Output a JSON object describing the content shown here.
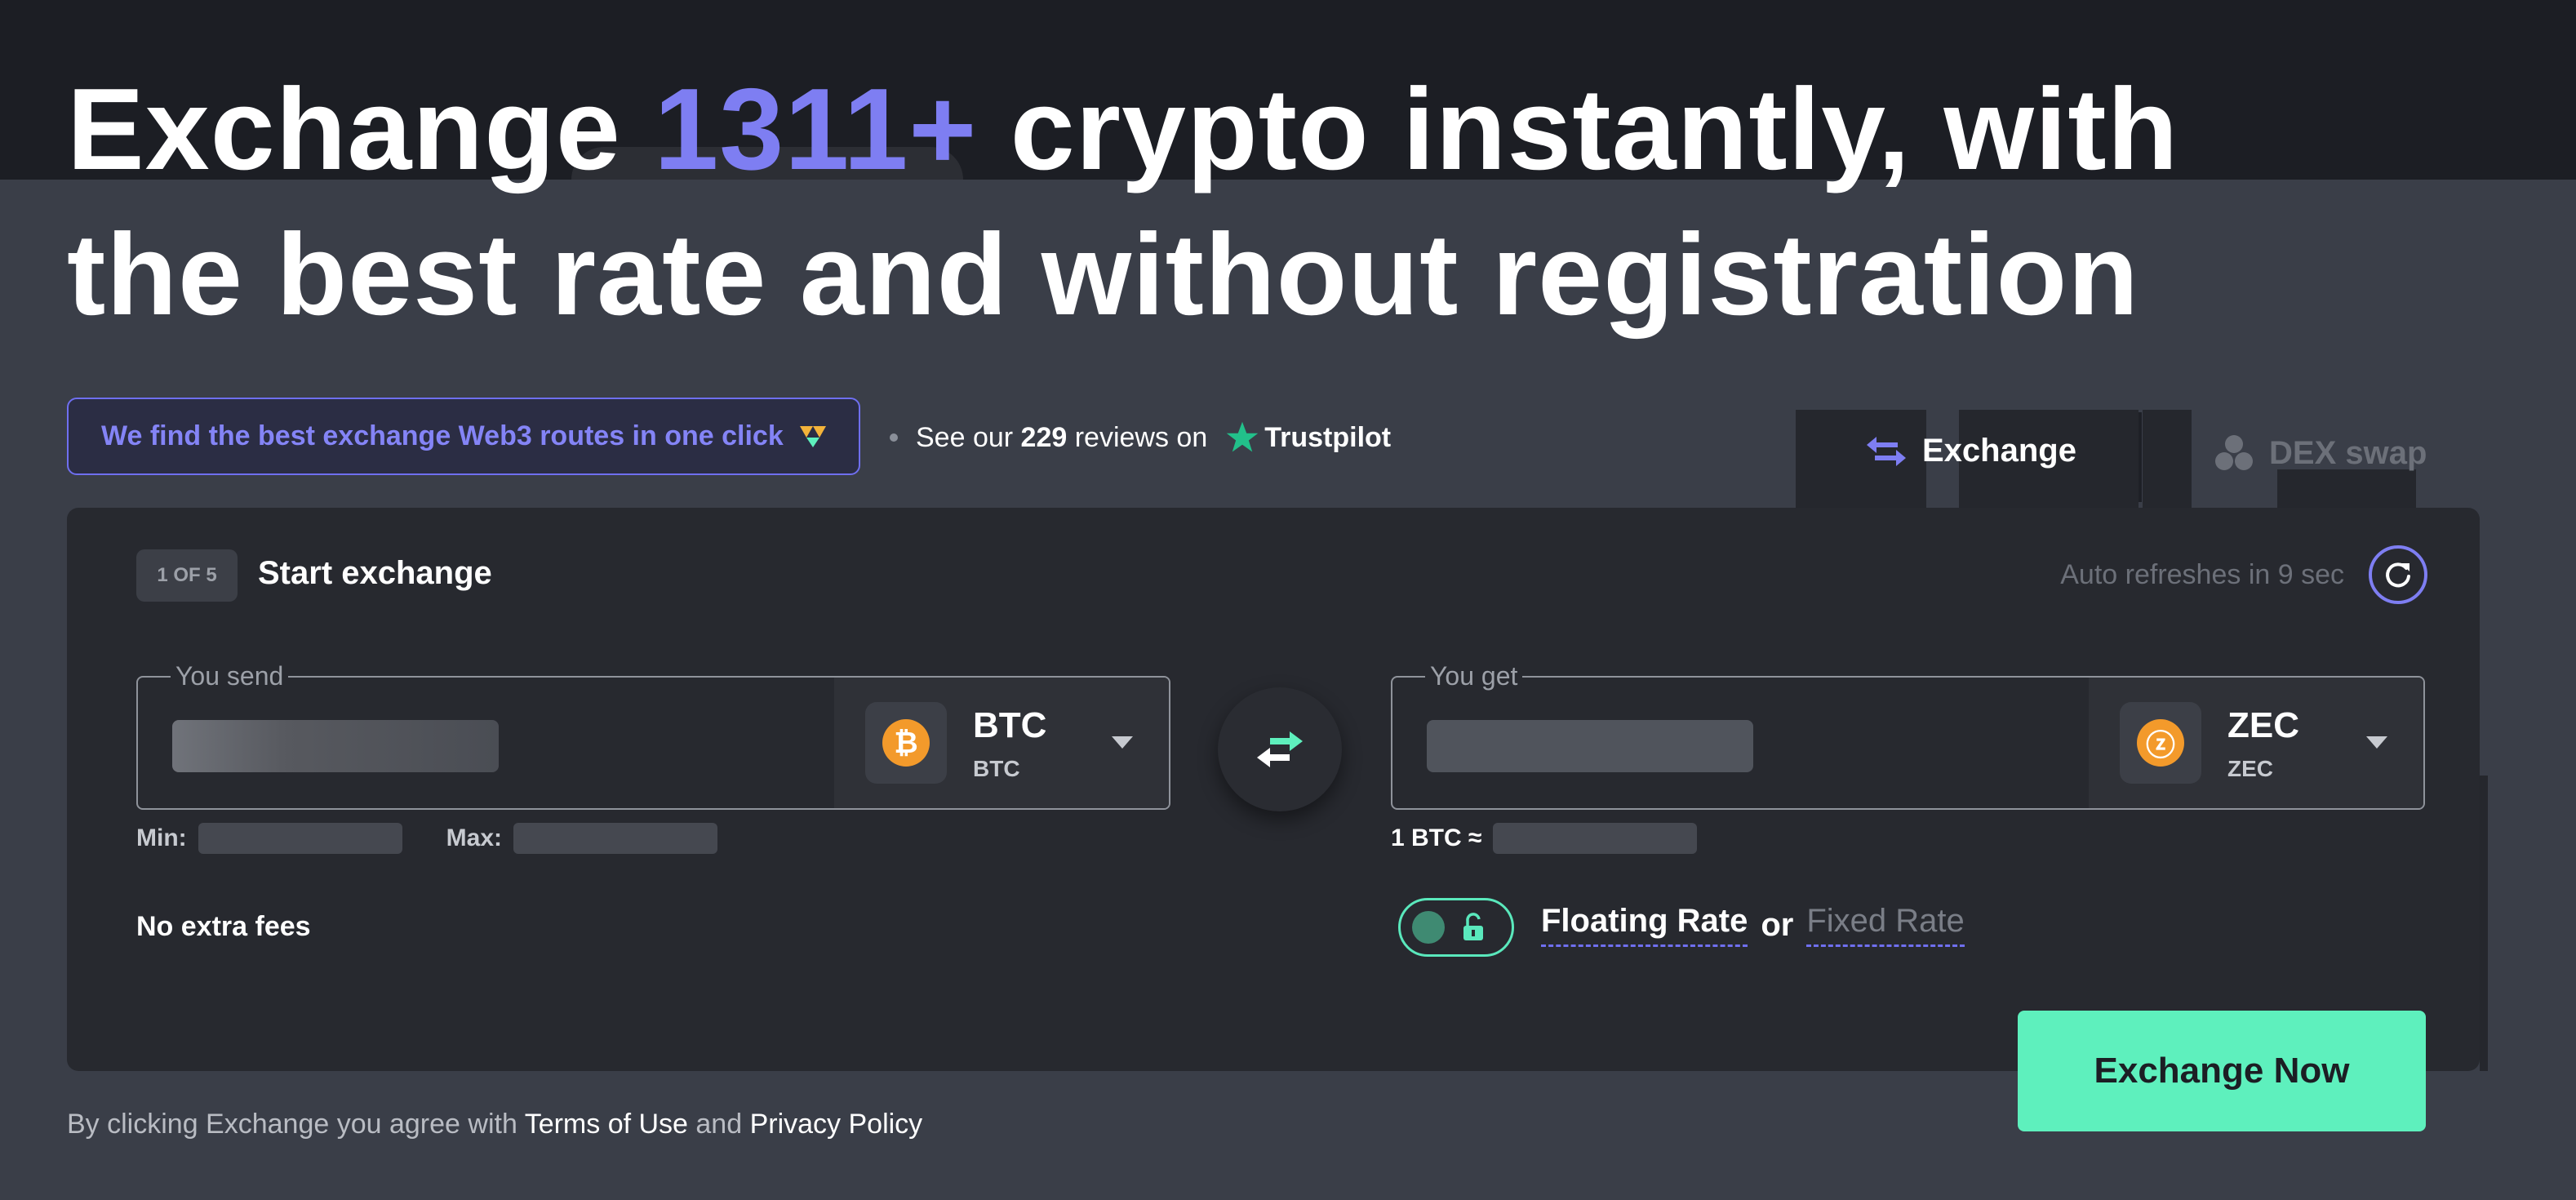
{
  "headline": {
    "pre": "Exchange ",
    "count": "1311+",
    "post": " crypto instantly, with the best rate and without registration"
  },
  "colors": {
    "accent": "#7e7ef2",
    "cta": "#5ef0bd",
    "bitcoin": "#f39a2b",
    "trustpilot": "#22c08a"
  },
  "routes_banner": {
    "label": "We find the best exchange Web3 routes in one click",
    "icon": "route-arrow-icon"
  },
  "reviews": {
    "prefix": "See our ",
    "count": "229",
    "suffix": " reviews on",
    "brand": "Trustpilot"
  },
  "tabs": [
    {
      "label": "Exchange",
      "icon": "swap-arrows-icon",
      "active": true
    },
    {
      "label": "DEX swap",
      "icon": "dex-circles-icon",
      "active": false
    }
  ],
  "step": {
    "badge": "1 OF 5",
    "title": "Start exchange"
  },
  "refresh": {
    "text": "Auto refreshes in 9 sec"
  },
  "send": {
    "legend": "You send",
    "ticker": "BTC",
    "network": "BTC",
    "coin_glyph": "₿",
    "min_label": "Min:",
    "max_label": "Max:"
  },
  "get": {
    "legend": "You get",
    "ticker": "ZEC",
    "network": "ZEC",
    "coin_glyph": "ⓩ",
    "rate_label": "1 BTC ≈"
  },
  "no_fees": "No extra fees",
  "rate_options": {
    "floating": "Floating Rate",
    "or": "or",
    "fixed": "Fixed Rate",
    "selected": "Floating Rate"
  },
  "cta_label": "Exchange Now",
  "legal": {
    "prefix": "By clicking Exchange you agree with ",
    "terms": "Terms of Use",
    "and": " and ",
    "privacy": "Privacy Policy"
  }
}
